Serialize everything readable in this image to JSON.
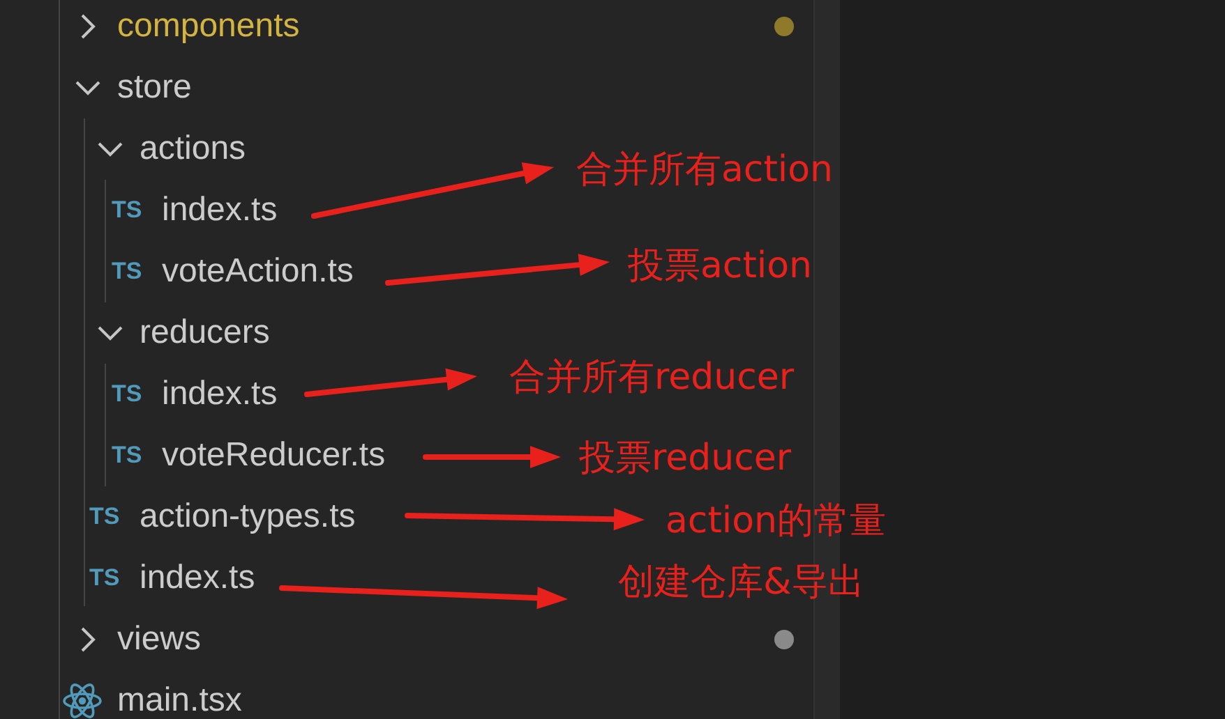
{
  "explorer": {
    "tree": [
      {
        "kind": "folder",
        "name": "components",
        "expanded": false,
        "modified": true,
        "color": "#8f7a2c"
      },
      {
        "kind": "folder",
        "name": "store",
        "expanded": true,
        "modified": false,
        "children": [
          {
            "kind": "folder",
            "name": "actions",
            "expanded": true,
            "children": [
              {
                "kind": "ts",
                "icon_text": "TS",
                "name": "index.ts"
              },
              {
                "kind": "ts",
                "icon_text": "TS",
                "name": "voteAction.ts"
              }
            ]
          },
          {
            "kind": "folder",
            "name": "reducers",
            "expanded": true,
            "children": [
              {
                "kind": "ts",
                "icon_text": "TS",
                "name": "index.ts"
              },
              {
                "kind": "ts",
                "icon_text": "TS",
                "name": "voteReducer.ts"
              }
            ]
          },
          {
            "kind": "ts",
            "icon_text": "TS",
            "name": "action-types.ts"
          },
          {
            "kind": "ts",
            "icon_text": "TS",
            "name": "index.ts"
          }
        ]
      },
      {
        "kind": "folder",
        "name": "views",
        "expanded": false,
        "modified": false,
        "color": "#8a8a8a"
      },
      {
        "kind": "react",
        "name": "main.tsx",
        "modified": false
      }
    ]
  },
  "annotations": [
    {
      "text": "合并所有action"
    },
    {
      "text": "投票action"
    },
    {
      "text": "合并所有reducer"
    },
    {
      "text": "投票reducer"
    },
    {
      "text": "action的常量"
    },
    {
      "text": "创建仓库&导出"
    }
  ]
}
